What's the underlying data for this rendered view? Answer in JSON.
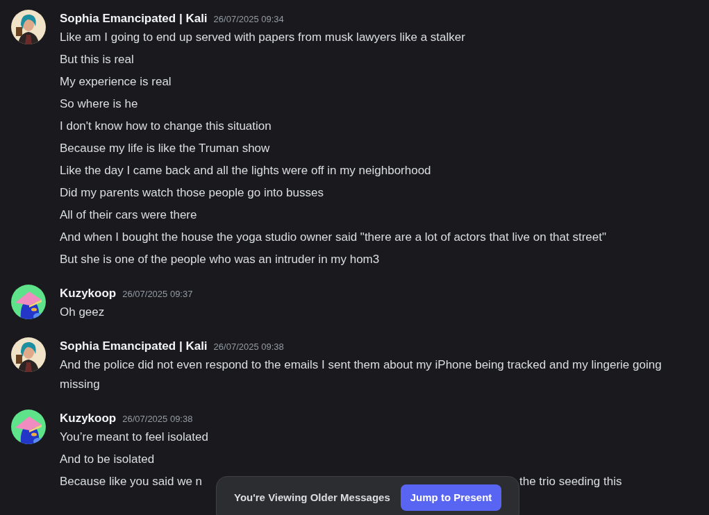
{
  "messages": [
    {
      "author": "Sophia Emancipated | Kali",
      "timestamp": "26/07/2025 09:34",
      "kind": "teal-hair",
      "lines": [
        "Like am I going to end up served with papers from musk lawyers like a stalker",
        "But this is real",
        "My experience is real",
        "So where is he",
        "I don't know how to change this situation",
        "Because my life is like the Truman show",
        "Like the day I came back and all the lights were off in my neighborhood",
        "Did my parents watch those people go into busses",
        "All of their cars were there",
        "And when I bought the house the yoga studio owner said \"there are a lot of actors that live on that street\"",
        "But she is one of the people who was an intruder in my hom3"
      ]
    },
    {
      "author": "Kuzykoop",
      "timestamp": "26/07/2025 09:37",
      "kind": "bird",
      "lines": [
        "Oh geez"
      ]
    },
    {
      "author": "Sophia Emancipated | Kali",
      "timestamp": "26/07/2025 09:38",
      "kind": "teal-hair",
      "lines": [
        "And the police did not even respond to the emails I sent them about my iPhone being tracked and my lingerie going missing"
      ]
    },
    {
      "author": "Kuzykoop",
      "timestamp": "26/07/2025 09:38",
      "kind": "bird",
      "lines": [
        "You’re meant to feel isolated",
        "And to be isolated"
      ],
      "covered_line": {
        "before": "Because like you said we n",
        "after": "the trio seeding this"
      }
    }
  ],
  "banner": {
    "text": "You're Viewing Older Messages",
    "button": "Jump to Present"
  }
}
